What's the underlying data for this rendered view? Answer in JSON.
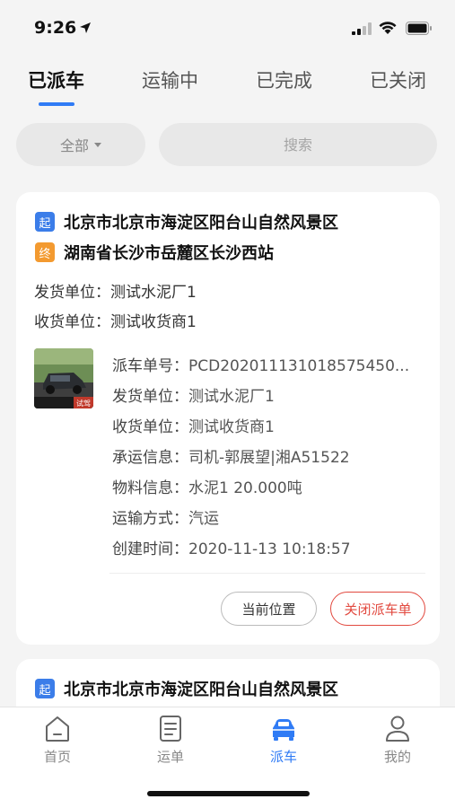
{
  "status_bar": {
    "time": "9:26"
  },
  "tabs": [
    {
      "label": "已派车",
      "active": true
    },
    {
      "label": "运输中",
      "active": false
    },
    {
      "label": "已完成",
      "active": false
    },
    {
      "label": "已关闭",
      "active": false
    }
  ],
  "filter": {
    "label": "全部",
    "search_placeholder": "搜索"
  },
  "cards": [
    {
      "start_badge": "起",
      "start": "北京市北京市海淀区阳台山自然风景区",
      "end_badge": "终",
      "end": "湖南省长沙市岳麓区长沙西站",
      "shipper": "发货单位：测试水泥厂1",
      "receiver": "收货单位：测试收货商1",
      "thumb_caption": "试驾",
      "details": [
        {
          "key": "派车单号：",
          "value": "PCD202011131018575450..."
        },
        {
          "key": "发货单位：",
          "value": "测试水泥厂1"
        },
        {
          "key": "收货单位：",
          "value": "测试收货商1"
        },
        {
          "key": "承运信息：",
          "value": "司机-郭展望|湘A51522"
        },
        {
          "key": "物料信息：",
          "value": "水泥1 20.000吨"
        },
        {
          "key": "运输方式：",
          "value": "汽运"
        },
        {
          "key": "创建时间：",
          "value": "2020-11-13 10:18:57"
        }
      ],
      "btn_location": "当前位置",
      "btn_close": "关闭派车单"
    },
    {
      "start_badge": "起",
      "start": "北京市北京市海淀区阳台山自然风景区"
    }
  ],
  "bottom_nav": [
    {
      "label": "首页",
      "icon": "home-icon",
      "active": false
    },
    {
      "label": "运单",
      "icon": "document-list-icon",
      "active": false
    },
    {
      "label": "派车",
      "icon": "car-icon",
      "active": true
    },
    {
      "label": "我的",
      "icon": "person-icon",
      "active": false
    }
  ],
  "colors": {
    "accent": "#2f7bf5",
    "danger": "#e2493f",
    "start_badge": "#3b7de9",
    "end_badge": "#f39a30"
  }
}
